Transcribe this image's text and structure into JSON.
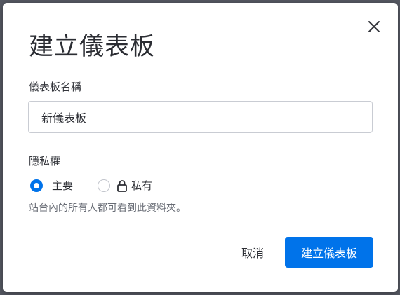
{
  "dialog": {
    "title": "建立儀表板",
    "close_icon": "close-icon"
  },
  "name_field": {
    "label": "儀表板名稱",
    "value": "新儀表板"
  },
  "privacy": {
    "label": "隱私權",
    "options": [
      {
        "label": "主要",
        "selected": true
      },
      {
        "label": "私有",
        "selected": false,
        "icon": "lock-icon"
      }
    ],
    "hint": "站台內的所有人都可看到此資料夾。"
  },
  "actions": {
    "cancel_label": "取消",
    "create_label": "建立儀表板"
  },
  "colors": {
    "accent": "#0073ea",
    "text": "#2b2d33",
    "muted": "#676b74",
    "border": "#c9ccd3"
  }
}
